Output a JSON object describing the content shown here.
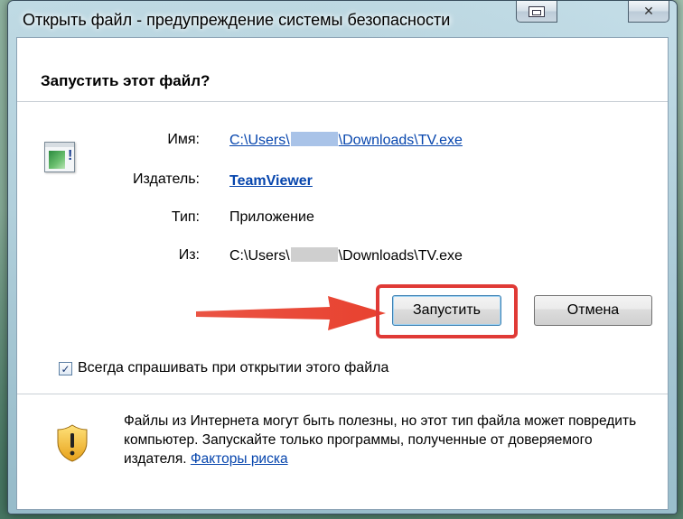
{
  "window": {
    "title": "Открыть файл - предупреждение системы безопасности",
    "close_glyph": "✕"
  },
  "dialog": {
    "heading": "Запустить этот файл?",
    "fields": {
      "name": {
        "label": "Имя:",
        "value_prefix": "C:\\Users\\",
        "value_suffix": "\\Downloads\\TV.exe"
      },
      "publisher": {
        "label": "Издатель:",
        "value": "TeamViewer"
      },
      "type": {
        "label": "Тип:",
        "value": "Приложение"
      },
      "from": {
        "label": "Из:",
        "value_prefix": "C:\\Users\\",
        "value_suffix": "\\Downloads\\TV.exe"
      }
    },
    "buttons": {
      "run": "Запустить",
      "cancel": "Отмена"
    },
    "checkbox": {
      "checked": true,
      "mark": "✓",
      "label": "Всегда спрашивать при открытии этого файла"
    },
    "warning": {
      "text": "Файлы из Интернета могут быть полезны, но этот тип файла может повредить компьютер. Запускайте только программы, полученные от доверяемого издателя.",
      "link": "Факторы риска"
    }
  },
  "icons": [
    "app-icon",
    "restore-icon",
    "close-icon",
    "arrow-annotation",
    "shield-warning-icon",
    "check-icon"
  ],
  "colors": {
    "link": "#0645ad",
    "highlight": "#e03a36",
    "arrow": "#e8412f"
  }
}
